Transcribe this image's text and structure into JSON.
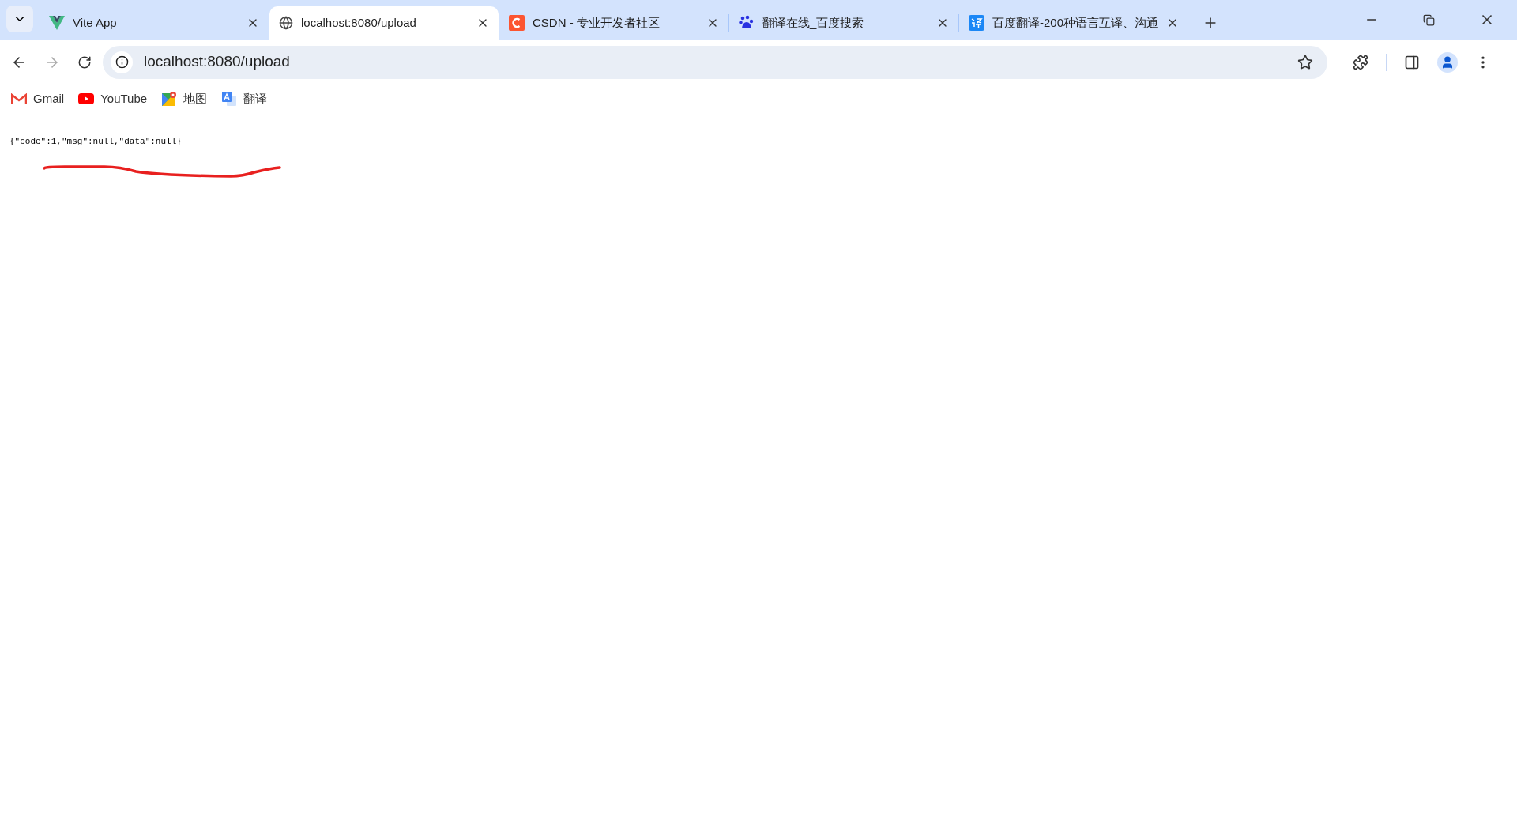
{
  "tabs": [
    {
      "kind": "vite",
      "title": "Vite App",
      "selected": false
    },
    {
      "kind": "globe",
      "title": "localhost:8080/upload",
      "selected": true
    },
    {
      "kind": "csdn",
      "title": "CSDN - 专业开发者社区",
      "selected": false
    },
    {
      "kind": "baidu",
      "title": "翻译在线_百度搜索",
      "selected": false
    },
    {
      "kind": "fanyi",
      "title": "百度翻译-200种语言互译、沟通",
      "selected": false
    }
  ],
  "toolbar": {
    "forward": {
      "disabled": true
    },
    "address": "localhost:8080/upload"
  },
  "bookmarks": [
    {
      "kind": "gmail",
      "label": "Gmail"
    },
    {
      "kind": "youtube",
      "label": "YouTube"
    },
    {
      "kind": "maps",
      "label": "地图"
    },
    {
      "kind": "translate",
      "label": "翻译"
    }
  ],
  "page": {
    "body": "{\"code\":1,\"msg\":null,\"data\":null}"
  }
}
